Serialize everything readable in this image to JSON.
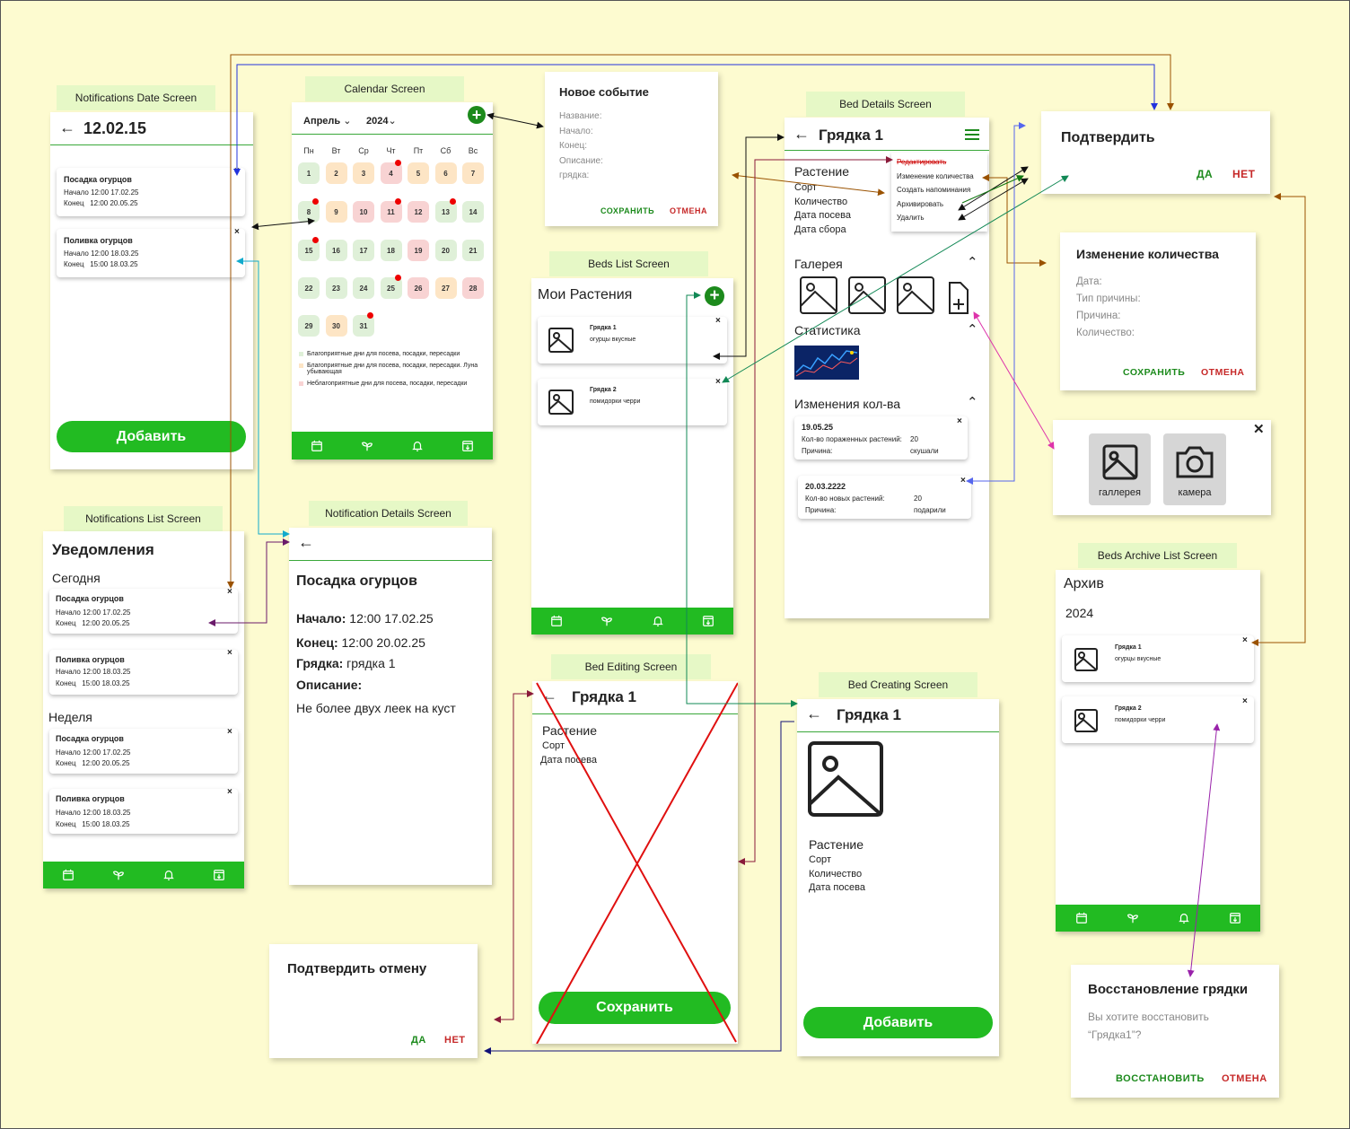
{
  "labels": {
    "notif_date": "Notifications Date Screen",
    "calendar": "Calendar Screen",
    "bed_details": "Bed Details Screen",
    "beds_list": "Beds List Screen",
    "notif_list": "Notifications List Screen",
    "notif_details": "Notification Details Screen",
    "bed_editing": "Bed Editing Screen",
    "bed_creating": "Bed Creating Screen",
    "beds_archive": "Beds Archive List Screen"
  },
  "notif_date": {
    "title": "12.02.15",
    "cards": [
      {
        "title": "Посадка огурцов",
        "start_k": "Начало",
        "start_v": "12:00 17.02.25",
        "end_k": "Конец",
        "end_v": "12:00 20.05.25"
      },
      {
        "title": "Поливка огурцов",
        "start_k": "Начало",
        "start_v": "12:00 18.03.25",
        "end_k": "Конец",
        "end_v": "15:00 18.03.25"
      }
    ],
    "add": "Добавить",
    "close": "×"
  },
  "calendar": {
    "month": "Апрель",
    "year": "2024",
    "weekdays": [
      "Пн",
      "Вт",
      "Ср",
      "Чт",
      "Пт",
      "Сб",
      "Вс"
    ],
    "legend": [
      "Благоприятные дни для посева, посадки, пересадки",
      "Благоприятные дни для посева, посадки, пересадки. Луна убывающая",
      "Неблагоприятные дни для посева, посадки, пересадки"
    ],
    "days": [
      {
        "n": "1",
        "c": "g"
      },
      {
        "n": "2",
        "c": "o"
      },
      {
        "n": "3",
        "c": "o"
      },
      {
        "n": "4",
        "c": "r",
        "dot": true
      },
      {
        "n": "5",
        "c": "o"
      },
      {
        "n": "6",
        "c": "o"
      },
      {
        "n": "7",
        "c": "o"
      },
      {
        "n": "8",
        "c": "g",
        "dot": true
      },
      {
        "n": "9",
        "c": "o"
      },
      {
        "n": "10",
        "c": "r"
      },
      {
        "n": "11",
        "c": "r",
        "dot": true
      },
      {
        "n": "12",
        "c": "r"
      },
      {
        "n": "13",
        "c": "g",
        "dot": true
      },
      {
        "n": "14",
        "c": "g"
      },
      {
        "n": "15",
        "c": "g",
        "dot": true
      },
      {
        "n": "16",
        "c": "g"
      },
      {
        "n": "17",
        "c": "g"
      },
      {
        "n": "18",
        "c": "g"
      },
      {
        "n": "19",
        "c": "r"
      },
      {
        "n": "20",
        "c": "g"
      },
      {
        "n": "21",
        "c": "g"
      },
      {
        "n": "22",
        "c": "g"
      },
      {
        "n": "23",
        "c": "g"
      },
      {
        "n": "24",
        "c": "g"
      },
      {
        "n": "25",
        "c": "g",
        "dot": true
      },
      {
        "n": "26",
        "c": "r"
      },
      {
        "n": "27",
        "c": "o"
      },
      {
        "n": "28",
        "c": "r"
      },
      {
        "n": "29",
        "c": "g"
      },
      {
        "n": "30",
        "c": "o"
      },
      {
        "n": "31",
        "c": "g",
        "dot": true
      }
    ]
  },
  "new_event": {
    "title": "Новое событие",
    "fields": [
      "Название:",
      "Начало:",
      "Конец:",
      "Описание:",
      "грядка:"
    ],
    "save": "СОХРАНИТЬ",
    "cancel": "ОТМЕНА"
  },
  "bed_details": {
    "title": "Грядка 1",
    "fields": [
      "Растение",
      "Сорт",
      "Количество",
      "Дата посева",
      "Дата сбора"
    ],
    "menu": [
      "Редактировать",
      "Изменение количества",
      "Создать напоминания",
      "Архивировать",
      "Удалить"
    ],
    "gallery": "Галерея",
    "stats": "Статистика",
    "changes": "Изменения кол-ва",
    "change_cards": [
      {
        "date": "19.05.25",
        "k1": "Кол-во пораженных растений:",
        "v1": "20",
        "k2": "Причина:",
        "v2": "скушали"
      },
      {
        "date": "20.03.2222",
        "k1": "Кол-во новых растений:",
        "v1": "20",
        "k2": "Причина:",
        "v2": "подарили"
      }
    ]
  },
  "confirm": {
    "title": "Подтвердить",
    "yes": "ДА",
    "no": "НЕТ"
  },
  "qty_change": {
    "title": "Изменение количества",
    "fields": [
      "Дата:",
      "Тип причины:",
      "Причина:",
      "Количество:"
    ],
    "save": "СОХРАНИТЬ",
    "cancel": "ОТМЕНА"
  },
  "picker": {
    "gallery": "галлерея",
    "camera": "камера",
    "close": "✕"
  },
  "beds_list": {
    "title": "Мои Растения",
    "items": [
      {
        "name": "Грядка 1",
        "desc": "огурцы вкусные"
      },
      {
        "name": "Грядка 2",
        "desc": "помидорки черри"
      }
    ]
  },
  "notif_list": {
    "title": "Уведомления",
    "today": "Сегодня",
    "week": "Неделя",
    "cards": [
      {
        "title": "Посадка огурцов",
        "start_k": "Начало",
        "start_v": "12:00 17.02.25",
        "end_k": "Конец",
        "end_v": "12:00 20.05.25"
      },
      {
        "title": "Поливка огурцов",
        "start_k": "Начало",
        "start_v": "12:00 18.03.25",
        "end_k": "Конец",
        "end_v": "15:00 18.03.25"
      },
      {
        "title": "Посадка огурцов",
        "start_k": "Начало",
        "start_v": "12:00 17.02.25",
        "end_k": "Конец",
        "end_v": "12:00 20.05.25"
      },
      {
        "title": "Поливка огурцов",
        "start_k": "Начало",
        "start_v": "12:00 18.03.25",
        "end_k": "Конец",
        "end_v": "15:00 18.03.25"
      }
    ]
  },
  "notif_details": {
    "title": "Посадка огурцов",
    "start_k": "Начало:",
    "start_v": "12:00 17.02.25",
    "end_k": "Конец:",
    "end_v": "12:00 20.02.25",
    "bed_k": "Грядка:",
    "bed_v": "грядка 1",
    "desc_k": "Описание:",
    "desc_v": "Не более двух леек на куст"
  },
  "bed_editing": {
    "title": "Грядка 1",
    "fields": [
      "Растение",
      "Сорт",
      "Дата посева"
    ],
    "save": "Сохранить"
  },
  "bed_creating": {
    "title": "Грядка 1",
    "fields": [
      "Растение",
      "Сорт",
      "Количество",
      "Дата посева"
    ],
    "add": "Добавить"
  },
  "cancel_confirm": {
    "title": "Подтвердить отмену",
    "yes": "ДА",
    "no": "НЕТ"
  },
  "archive": {
    "title": "Архив",
    "year": "2024",
    "items": [
      {
        "name": "Грядка 1",
        "desc": "огурцы вкусные"
      },
      {
        "name": "Грядка 2",
        "desc": "помидорки черри"
      }
    ]
  },
  "restore": {
    "title": "Восстановление грядки",
    "text1": "Вы хотите восстановить",
    "text2": "“Грядка1”?",
    "restore": "ВОССТАНОВИТЬ",
    "cancel": "ОТМЕНА"
  },
  "colors": {
    "bg": "#fdfbd0",
    "green": "#22bb22",
    "dark_green": "#1c8a1c",
    "red": "#c62828",
    "tag": "#e6f8c6"
  }
}
